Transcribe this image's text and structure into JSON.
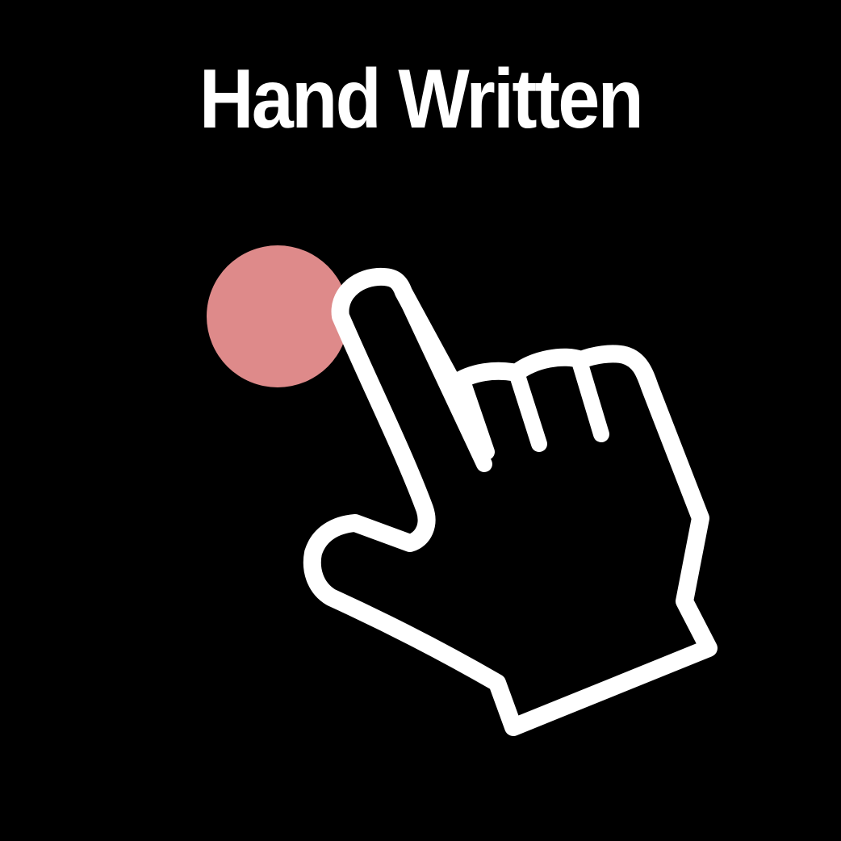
{
  "title": "Hand Written",
  "icon": {
    "name": "pointing-hand-icon",
    "touch_dot": "touch-point-icon"
  },
  "colors": {
    "background": "#000000",
    "text": "#ffffff",
    "hand_outline": "#ffffff",
    "hand_fill": "#000000",
    "touch_dot": "#de8a8a"
  }
}
